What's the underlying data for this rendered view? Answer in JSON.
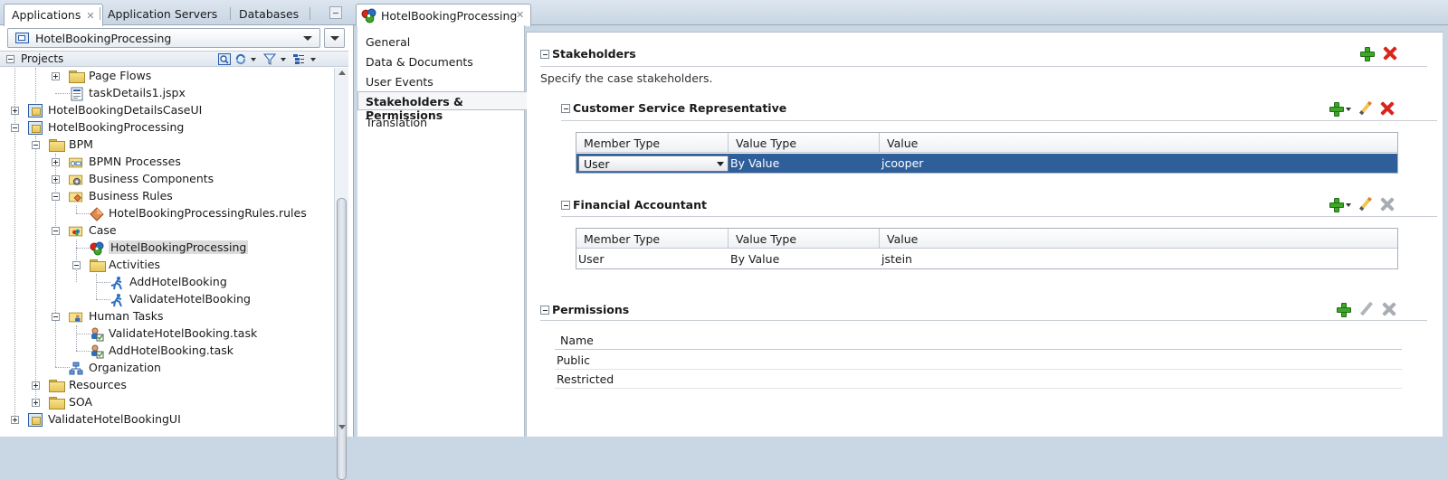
{
  "left_panel": {
    "tabs": [
      {
        "label": "Applications",
        "active": true,
        "closable": true
      },
      {
        "label": "Application Servers",
        "active": false
      },
      {
        "label": "Databases",
        "active": false
      }
    ],
    "app_selector": {
      "value": "HotelBookingProcessing"
    },
    "projects_label": "Projects",
    "tree": [
      {
        "label": "Page Flows",
        "icon": "folder-icon",
        "expander": "plus"
      },
      {
        "label": "taskDetails1.jspx",
        "icon": "jspx-file-icon",
        "expander": "none"
      },
      {
        "label": "HotelBookingDetailsCaseUI",
        "icon": "project-icon",
        "expander": "plus"
      },
      {
        "label": "HotelBookingProcessing",
        "icon": "project-icon",
        "expander": "minus"
      },
      {
        "label": "BPM",
        "icon": "folder-icon",
        "expander": "minus"
      },
      {
        "label": "BPMN Processes",
        "icon": "bpmn-folder-icon",
        "expander": "plus"
      },
      {
        "label": "Business Components",
        "icon": "components-folder-icon",
        "expander": "plus"
      },
      {
        "label": "Business Rules",
        "icon": "rules-folder-icon",
        "expander": "minus"
      },
      {
        "label": "HotelBookingProcessingRules.rules",
        "icon": "rules-file-icon",
        "expander": "none"
      },
      {
        "label": "Case",
        "icon": "case-folder-icon",
        "expander": "minus"
      },
      {
        "label": "HotelBookingProcessing",
        "icon": "case-icon",
        "expander": "none",
        "selected": true
      },
      {
        "label": "Activities",
        "icon": "folder-icon",
        "expander": "minus"
      },
      {
        "label": "AddHotelBooking",
        "icon": "activity-icon",
        "expander": "none"
      },
      {
        "label": "ValidateHotelBooking",
        "icon": "activity-icon",
        "expander": "none"
      },
      {
        "label": "Human Tasks",
        "icon": "tasks-folder-icon",
        "expander": "minus"
      },
      {
        "label": "ValidateHotelBooking.task",
        "icon": "task-file-icon",
        "expander": "none"
      },
      {
        "label": "AddHotelBooking.task",
        "icon": "task-file-icon",
        "expander": "none"
      },
      {
        "label": "Organization",
        "icon": "organization-icon",
        "expander": "none"
      },
      {
        "label": "Resources",
        "icon": "folder-icon",
        "expander": "plus"
      },
      {
        "label": "SOA",
        "icon": "folder-icon",
        "expander": "plus"
      },
      {
        "label": "ValidateHotelBookingUI",
        "icon": "project-icon",
        "expander": "plus"
      }
    ]
  },
  "editor": {
    "tab_label": "HotelBookingProcessing",
    "nav": [
      {
        "label": "General",
        "active": false
      },
      {
        "label": "Data & Documents",
        "active": false
      },
      {
        "label": "User Events",
        "active": false
      },
      {
        "label": "Stakeholders & Permissions",
        "active": true
      },
      {
        "label": "Translation",
        "active": false
      }
    ],
    "stakeholders": {
      "title": "Stakeholders",
      "description": "Specify the case stakeholders.",
      "groups": [
        {
          "name": "Customer Service Representative",
          "columns": [
            "Member Type",
            "Value Type",
            "Value"
          ],
          "rows": [
            {
              "member_type": "User",
              "value_type": "By Value",
              "value": "jcooper",
              "selected": true
            }
          ],
          "delete_enabled": true
        },
        {
          "name": "Financial Accountant",
          "columns": [
            "Member Type",
            "Value Type",
            "Value"
          ],
          "rows": [
            {
              "member_type": "User",
              "value_type": "By Value",
              "value": "jstein",
              "selected": false
            }
          ],
          "delete_enabled": false
        }
      ]
    },
    "permissions": {
      "title": "Permissions",
      "column": "Name",
      "rows": [
        "Public",
        "Restricted"
      ]
    }
  }
}
